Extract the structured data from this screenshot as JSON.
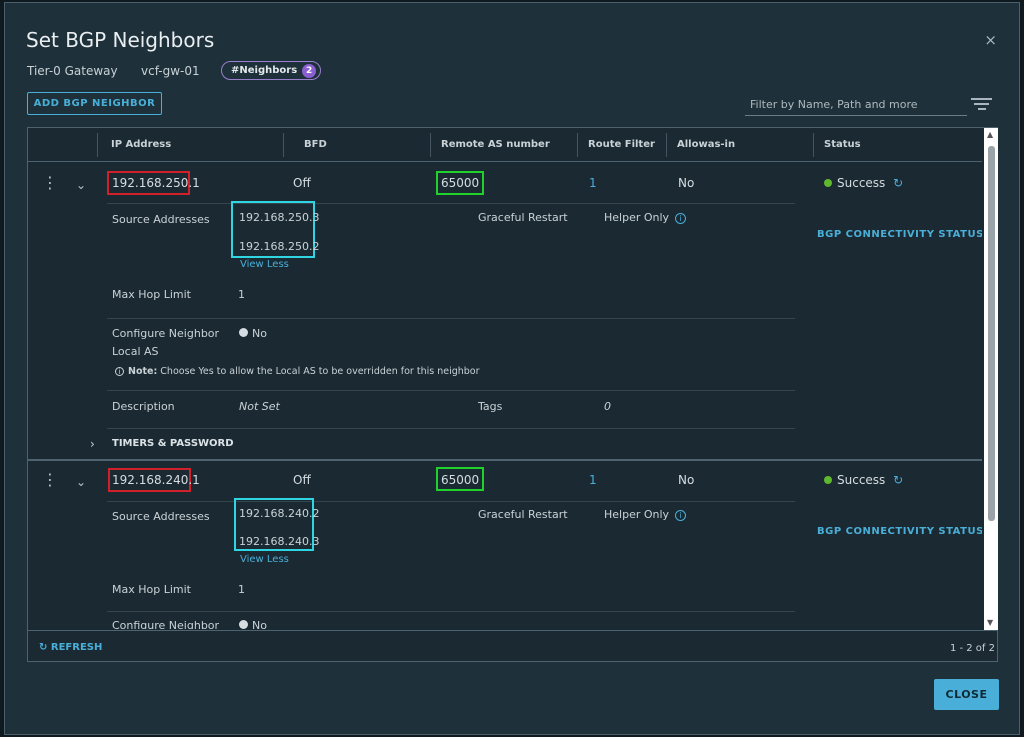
{
  "dialog": {
    "title": "Set BGP Neighbors",
    "gateway_type": "Tier-0 Gateway",
    "gateway_name": "vcf-gw-01",
    "neighbors_pill": "#Neighbors",
    "neighbors_count": "2",
    "close_glyph": "×"
  },
  "toolbar": {
    "add_label": "ADD BGP NEIGHBOR",
    "filter_placeholder": "Filter by Name, Path and more"
  },
  "columns": [
    "IP Address",
    "BFD",
    "Remote AS number",
    "Route Filter",
    "Allowas-in",
    "Status"
  ],
  "neighbors": [
    {
      "ip": "192.168.250.1",
      "bfd": "Off",
      "remote_as": "65000",
      "route_filter": "1",
      "allowas_in": "No",
      "status": "Success",
      "status_color": "#5fb82d",
      "bgp_link": "BGP CONNECTIVITY STATUS",
      "source_label": "Source Addresses",
      "source_addresses": [
        "192.168.250.3",
        "192.168.250.2"
      ],
      "view_less": "View Less",
      "graceful_label": "Graceful Restart",
      "graceful_value": "Helper Only",
      "max_hop_label": "Max Hop Limit",
      "max_hop_value": "1",
      "local_as_label_1": "Configure Neighbor",
      "local_as_label_2": "Local AS",
      "local_as_value": "No",
      "note_bold": "Note:",
      "note_text": "Choose Yes to allow the Local AS to be overridden for this neighbor",
      "desc_label": "Description",
      "desc_value": "Not Set",
      "tags_label": "Tags",
      "tags_value": "0",
      "timers_label": "TIMERS & PASSWORD"
    },
    {
      "ip": "192.168.240.1",
      "bfd": "Off",
      "remote_as": "65000",
      "route_filter": "1",
      "allowas_in": "No",
      "status": "Success",
      "status_color": "#5fb82d",
      "bgp_link": "BGP CONNECTIVITY STATUS",
      "source_label": "Source Addresses",
      "source_addresses": [
        "192.168.240.2",
        "192.168.240.3"
      ],
      "view_less": "View Less",
      "graceful_label": "Graceful Restart",
      "graceful_value": "Helper Only",
      "max_hop_label": "Max Hop Limit",
      "max_hop_value": "1",
      "local_as_label_1": "Configure Neighbor",
      "local_as_value": "No"
    }
  ],
  "footer": {
    "refresh_label": "REFRESH",
    "pager_text": "1 - 2 of 2"
  },
  "actions": {
    "close_label": "CLOSE"
  },
  "colors": {
    "accent": "#49afd9",
    "success": "#5fb82d",
    "ip_highlight": "#d0202a",
    "as_highlight": "#1fd12a",
    "source_highlight": "#2fd5e0"
  }
}
